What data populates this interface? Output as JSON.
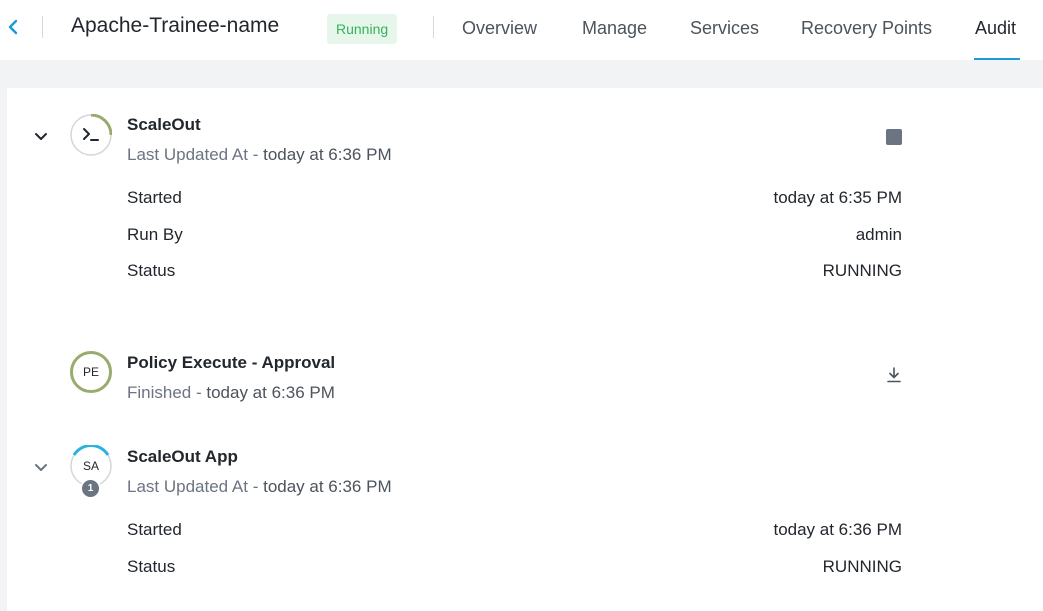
{
  "header": {
    "app_name": "Apache-Trainee-name",
    "state": "Running",
    "tabs": [
      "Overview",
      "Manage",
      "Services",
      "Recovery Points",
      "Audit"
    ],
    "active_tab": "Audit"
  },
  "audit": {
    "entries": [
      {
        "title": "ScaleOut",
        "subtitle_prefix": "Last Updated At - ",
        "subtitle_time": "today at 6:36 PM",
        "icon": "terminal-icon",
        "action_icon": "stop-icon",
        "details": [
          {
            "label": "Started",
            "value": "today at 6:35 PM"
          },
          {
            "label": "Run By",
            "value": "admin"
          },
          {
            "label": "Status",
            "value": "RUNNING"
          }
        ]
      },
      {
        "title": "Policy Execute - Approval",
        "subtitle_prefix": "Finished - ",
        "subtitle_time": "today at 6:36 PM",
        "icon_text": "PE",
        "action_icon": "download-icon"
      },
      {
        "title": "ScaleOut App",
        "subtitle_prefix": "Last Updated At - ",
        "subtitle_time": "today at 6:36 PM",
        "icon_text": "SA",
        "badge_count": "1",
        "details": [
          {
            "label": "Started",
            "value": "today at 6:36 PM"
          },
          {
            "label": "Status",
            "value": "RUNNING"
          }
        ]
      }
    ]
  },
  "colors": {
    "accent": "#1b9ad6",
    "success_bg": "#e6f6ea",
    "success_text": "#36b25a",
    "timeline_green": "#9aab6e",
    "timeline_blue": "#2bb3e0"
  }
}
